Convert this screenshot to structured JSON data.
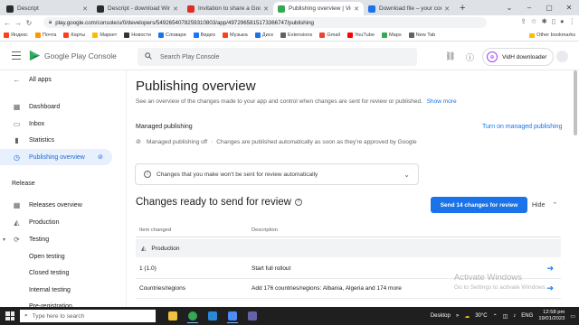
{
  "browser": {
    "tabs": [
      {
        "title": "Descript",
        "color": "#2b2b2b",
        "active": false
      },
      {
        "title": "Descript - download Windo",
        "color": "#2b2b2b",
        "active": false
      },
      {
        "title": "Invitation to share a Google",
        "color": "#d93025",
        "active": false
      },
      {
        "title": "Publishing overview | VidH",
        "color": "#34a853",
        "active": true
      },
      {
        "title": "Download file – your conver",
        "color": "#1a73e8",
        "active": false
      }
    ],
    "url": "play.google.com/console/u/0/developers/5492654078259310803/app/4972965815173366747/publishing",
    "bookmarks": [
      "Яндекс",
      "Почта",
      "Карты",
      "Маркет",
      "Новости",
      "Словари",
      "Видео",
      "Музыка",
      "Диск",
      "Extensions",
      "Gmail",
      "YouTube",
      "Maps",
      "New Tab"
    ],
    "bookmark_colors": [
      "#fc3f1d",
      "#ff9800",
      "#fc3f1d",
      "#fbbc04",
      "#333333",
      "#1a73e8",
      "#1877f2",
      "#fc3f1d",
      "#1a73e8",
      "#5f6368",
      "#ea4335",
      "#ff0000",
      "#34a853",
      "#5f6368"
    ],
    "other_bookmarks": "Other bookmarks"
  },
  "header": {
    "product": "Google Play Console",
    "search_placeholder": "Search Play Console",
    "developer": "VidH downloader"
  },
  "sidebar": {
    "all_apps": "All apps",
    "items": [
      {
        "label": "Dashboard",
        "icon": "dashboard-icon",
        "glyph": "▦"
      },
      {
        "label": "Inbox",
        "icon": "inbox-icon",
        "glyph": "▭"
      },
      {
        "label": "Statistics",
        "icon": "statistics-icon",
        "glyph": "▮"
      },
      {
        "label": "Publishing overview",
        "icon": "publishing-icon",
        "glyph": "◷"
      }
    ],
    "release_section": "Release",
    "release_items": [
      {
        "label": "Releases overview",
        "icon": "releases-icon",
        "glyph": "▦"
      },
      {
        "label": "Production",
        "icon": "production-icon",
        "glyph": "◭"
      },
      {
        "label": "Testing",
        "icon": "testing-icon",
        "glyph": "⟳"
      },
      {
        "label": "Open testing"
      },
      {
        "label": "Closed testing"
      },
      {
        "label": "Internal testing"
      },
      {
        "label": "Pre-registration"
      }
    ]
  },
  "main": {
    "title": "Publishing overview",
    "description": "See an overview of the changes made to your app and control when changes are sent for review or published.",
    "show_more": "Show more",
    "managed_title": "Managed publishing",
    "turn_on": "Turn on managed publishing",
    "managed_status": "Managed publishing off",
    "managed_desc": "Changes are published automatically as soon as they're approved by Google",
    "info_text": "Changes that you make won't be sent for review automatically",
    "changes_title": "Changes ready to send for review",
    "send_button": "Send 14 changes for review",
    "hide": "Hide",
    "columns": [
      "Item changed",
      "Description"
    ],
    "group": "Production",
    "rows": [
      {
        "item": "1 (1.0)",
        "description": "Start full rollout"
      },
      {
        "item": "Countries/regions",
        "description": "Add 176 countries/regions: Albania, Algeria and 174 more"
      },
      {
        "item": "",
        "description": ""
      }
    ]
  },
  "watermark": {
    "line1": "Activate Windows",
    "line2": "Go to Settings to activate Windows."
  },
  "taskbar": {
    "search_placeholder": "Type here to search",
    "desktop": "Desktop",
    "weather": "30°C",
    "lang": "ENG",
    "time": "12:58 pm",
    "date": "19/01/2023",
    "apps": [
      "#f0c040",
      "#34a853",
      "#2b88d8",
      "#4d8bf5",
      "#6264a7"
    ]
  }
}
